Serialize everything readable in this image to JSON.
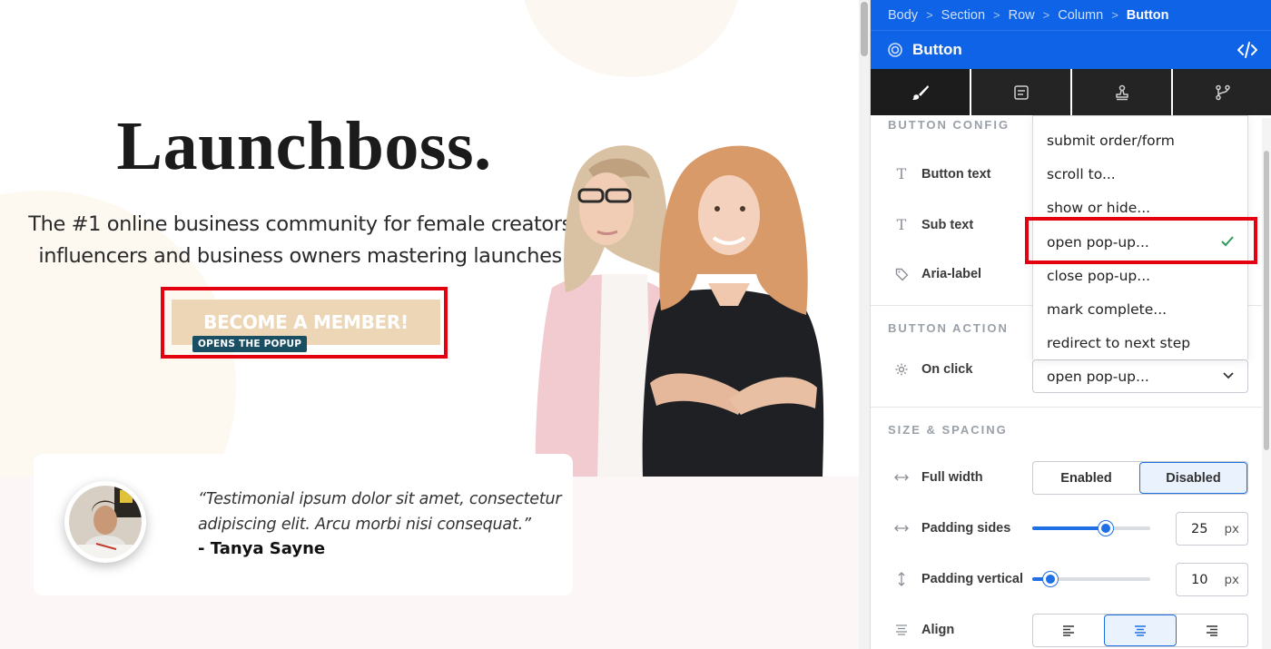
{
  "canvas": {
    "hero_title": "Launchboss.",
    "hero_subtitle_line1": "The #1 online business community for female creators,",
    "hero_subtitle_line2": "influencers and business owners mastering launches.",
    "cta_label": "BECOME A MEMBER!",
    "cta_subtext": "OPENS THE POPUP",
    "testimonial_quote": "“Testimonial ipsum dolor sit amet, consectetur adipiscing elit. Arcu morbi nisi consequat.”",
    "testimonial_author": "- Tanya Sayne"
  },
  "breadcrumb": [
    "Body",
    "Section",
    "Row",
    "Column",
    "Button"
  ],
  "panel": {
    "title": "Button",
    "accent_color": "#0e63e6",
    "tabs": [
      "brush-icon",
      "form-icon",
      "stamp-icon",
      "branch-icon"
    ],
    "button_config": {
      "section_title": "BUTTON CONFIG",
      "button_text_label": "Button text",
      "sub_text_label": "Sub text",
      "aria_label_label": "Aria-label"
    },
    "button_action": {
      "section_title": "BUTTON ACTION",
      "on_click_label": "On click",
      "selected": "open pop-up...",
      "options": [
        "submit order/form",
        "scroll to...",
        "show or hide...",
        "open pop-up...",
        "close pop-up...",
        "mark complete...",
        "redirect to next step"
      ]
    },
    "size_spacing": {
      "section_title": "SIZE & SPACING",
      "full_width_label": "Full width",
      "full_width_options": [
        "Enabled",
        "Disabled"
      ],
      "full_width_selected": "Disabled",
      "padding_sides_label": "Padding sides",
      "padding_sides_value": "25",
      "padding_sides_fraction": 0.62,
      "padding_vertical_label": "Padding vertical",
      "padding_vertical_value": "10",
      "padding_vertical_fraction": 0.15,
      "unit": "px",
      "align_label": "Align",
      "align_selected": "center"
    }
  }
}
